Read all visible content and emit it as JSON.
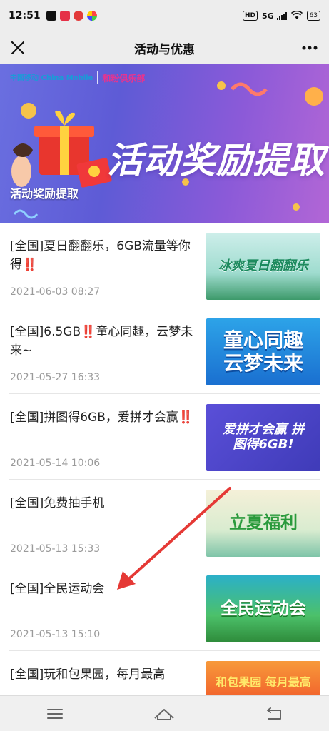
{
  "status_bar": {
    "time": "12:51",
    "network": "5G",
    "battery": "63",
    "hd": "HD"
  },
  "nav": {
    "title": "活动与优惠"
  },
  "banner": {
    "logo_cmcc": "中国移动 China Mobile",
    "logo_club": "和粉俱乐部",
    "headline": "活动奖励提取",
    "caption": "活动奖励提取"
  },
  "list": [
    {
      "title": "[全国]夏日翻翻乐，6GB流量等你得",
      "bang": "‼️",
      "date": "2021-06-03 08:27",
      "thumb_text": "冰爽夏日翻翻乐"
    },
    {
      "title": "[全国]6.5GB",
      "bang": "‼️",
      "title_tail": "童心同趣，云梦未来~",
      "date": "2021-05-27 16:33",
      "thumb_text": "童心同趣 云梦未来"
    },
    {
      "title": "[全国]拼图得6GB，爱拼才会赢",
      "bang": "‼️",
      "date": "2021-05-14 10:06",
      "thumb_text": "爱拼才会赢 拼图得6GB!"
    },
    {
      "title": "[全国]免费抽手机",
      "date": "2021-05-13 15:33",
      "thumb_text": "立夏福利"
    },
    {
      "title": "[全国]全民运动会",
      "date": "2021-05-13 15:10",
      "thumb_text": "全民运动会"
    },
    {
      "title": "[全国]玩和包果园，每月最高",
      "date": "",
      "thumb_text": "和包果园 每月最高"
    }
  ],
  "colors": {
    "annotation_arrow": "#e53935",
    "date_gray": "#9a9a9a",
    "nav_bg": "#ededed"
  }
}
